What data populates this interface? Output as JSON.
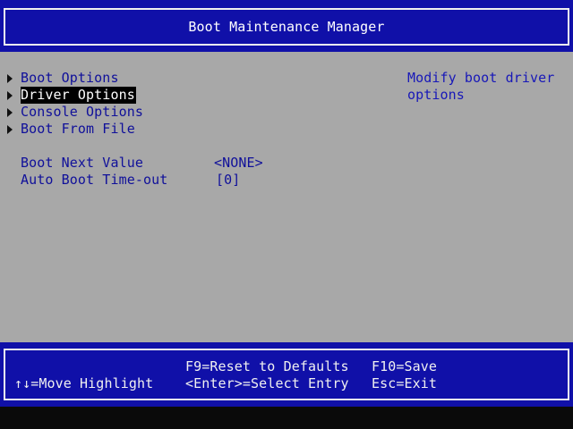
{
  "header": {
    "title": "Boot Maintenance Manager"
  },
  "menu": {
    "items": [
      {
        "label": "Boot Options",
        "selected": false
      },
      {
        "label": "Driver Options",
        "selected": true
      },
      {
        "label": "Console Options",
        "selected": false
      },
      {
        "label": "Boot From File",
        "selected": false
      }
    ]
  },
  "settings": [
    {
      "label": "Boot Next Value",
      "value": "<NONE>"
    },
    {
      "label": "Auto Boot Time-out",
      "value": "[0]"
    }
  ],
  "help": {
    "line1": "Modify boot driver",
    "line2": "options"
  },
  "footer": {
    "move_highlight": "↑↓=Move Highlight",
    "reset_defaults": "F9=Reset to Defaults",
    "select_entry": "<Enter>=Select Entry",
    "save": "F10=Save",
    "exit": "Esc=Exit"
  },
  "colors": {
    "band_blue": "#1010a8",
    "panel_gray": "#a8a8a8",
    "menu_text": "#10109a",
    "help_text": "#1818b8",
    "selected_bg": "#000000",
    "selected_fg": "#ffffff"
  },
  "icons": {
    "submenu_marker": "triangle-right-icon"
  }
}
